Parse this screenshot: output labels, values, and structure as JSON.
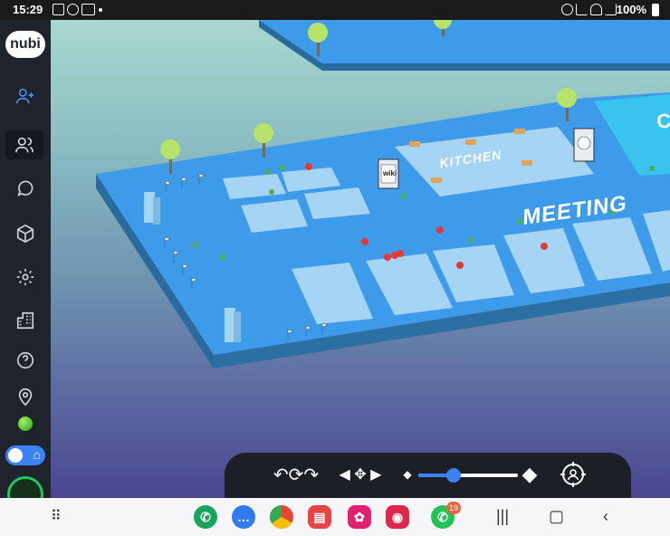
{
  "status_bar": {
    "time": "15:29",
    "battery": "100%"
  },
  "sidebar": {
    "logo": "nubi",
    "items": [
      {
        "name": "add-user"
      },
      {
        "name": "users"
      },
      {
        "name": "chat"
      },
      {
        "name": "cube"
      },
      {
        "name": "settings"
      },
      {
        "name": "building"
      },
      {
        "name": "help"
      },
      {
        "name": "location"
      }
    ]
  },
  "scene": {
    "rooms": {
      "kitchen": "KITCHEN",
      "meeting": "MEETING",
      "partial": "C"
    },
    "signs": {
      "wiki": "wiki"
    },
    "colors": {
      "floor": "#3d9be9",
      "pad": "#a6d4f4",
      "side": "#2a6a9c"
    }
  },
  "controls": {
    "zoom_level": 0.35
  },
  "navbar": {
    "whatsapp_badge": "19",
    "apps": [
      "phone",
      "messages",
      "chrome",
      "notes",
      "gallery",
      "camera",
      "whatsapp"
    ]
  }
}
